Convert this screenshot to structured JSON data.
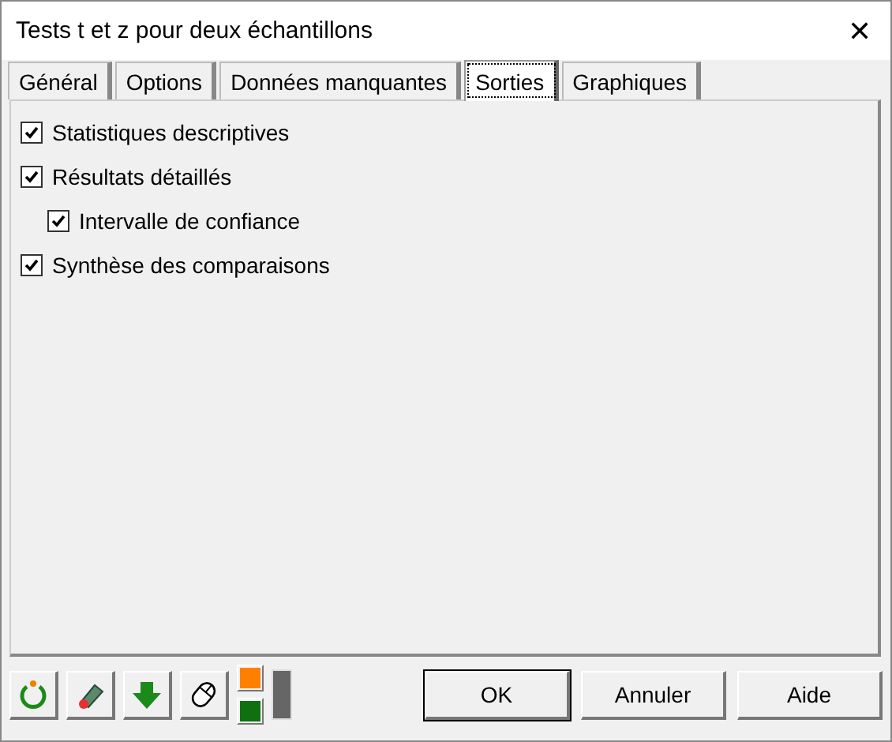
{
  "window": {
    "title": "Tests t et z pour deux échantillons",
    "close": "✕"
  },
  "tabs": [
    {
      "label": "Général",
      "selected": false
    },
    {
      "label": "Options",
      "selected": false
    },
    {
      "label": "Données manquantes",
      "selected": false
    },
    {
      "label": "Sorties",
      "selected": true
    },
    {
      "label": "Graphiques",
      "selected": false
    }
  ],
  "options": [
    {
      "label": "Statistiques descriptives",
      "checked": true
    },
    {
      "label": "Résultats détaillés",
      "checked": true,
      "children": [
        {
          "label": "Intervalle de confiance",
          "checked": true
        }
      ]
    },
    {
      "label": "Synthèse des comparaisons",
      "checked": true
    }
  ],
  "buttons": [
    "OK",
    "Annuler",
    "Aide"
  ]
}
